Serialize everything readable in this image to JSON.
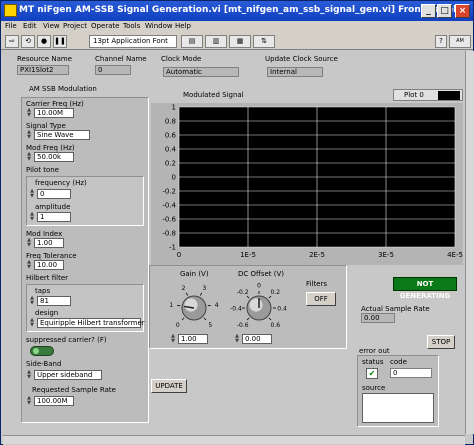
{
  "window": {
    "title": "MT niFgen AM-SSB Signal Generation.vi [mt_nifgen_am_ssb_signal_gen.vi] Front Panel"
  },
  "menu": [
    "File",
    "Edit",
    "View",
    "Project",
    "Operate",
    "Tools",
    "Window",
    "Help"
  ],
  "toolbar": {
    "font": "13pt Application Font"
  },
  "top": {
    "resource_name_label": "Resource Name",
    "resource_name": "PXI1Slot2",
    "channel_name_label": "Channel Name",
    "channel_name": "0",
    "clock_mode_label": "Clock Mode",
    "clock_mode": "Automatic",
    "update_clock_label": "Update Clock Source",
    "update_clock": "Internal"
  },
  "am": {
    "group_label": "AM SSB Modulation",
    "carrier_label": "Carrier Freq (Hz)",
    "carrier": "10.00M",
    "signal_type_label": "Signal Type",
    "signal_type": "Sine Wave",
    "mod_freq_label": "Mod Freq (Hz)",
    "mod_freq": "50.00k",
    "pilot_label": "Pilot tone",
    "pilot_freq_label": "frequency (Hz)",
    "pilot_freq": "0",
    "pilot_amp_label": "amplitude",
    "pilot_amp": "1",
    "mod_index_label": "Mod Index",
    "mod_index": "1.00",
    "freq_tol_label": "Freq Tolerance",
    "freq_tol": "10.00",
    "hilbert_label": "Hilbert filter",
    "taps_label": "taps",
    "taps": "81",
    "design_label": "design",
    "design": "Equiripple Hilbert transformer",
    "suppressed_label": "suppressed carrier? (F)",
    "sideband_label": "Side-Band",
    "sideband": "Upper sideband",
    "req_rate_label": "Requested Sample Rate",
    "req_rate": "100.00M"
  },
  "chart_data": {
    "type": "line",
    "title": "Modulated Signal",
    "legend": "Plot 0",
    "xlim": [
      0,
      4e-05
    ],
    "ylim": [
      -1,
      1
    ],
    "x_ticks": [
      "0",
      "1E-5",
      "2E-5",
      "3E-5",
      "4E-5"
    ],
    "y_ticks": [
      "1",
      "0.8",
      "0.6",
      "0.4",
      "0.2",
      "0",
      "-0.2",
      "-0.4",
      "-0.6",
      "-0.8",
      "-1"
    ],
    "series": [],
    "grid": true
  },
  "knobs": {
    "gain_label": "Gain (V)",
    "gain_ticks": [
      "0",
      "1",
      "2",
      "3",
      "4",
      "5"
    ],
    "gain_value": "1.00",
    "gain_fraction": 0.2,
    "offset_label": "DC Offset (V)",
    "offset_ticks": [
      "-0.6",
      "-0.4",
      "-0.2",
      "0",
      "0.2",
      "0.4",
      "0.6"
    ],
    "offset_value": "0.00",
    "offset_fraction": 0.5
  },
  "filters": {
    "label": "Filters",
    "state": "OFF"
  },
  "status": {
    "not_generating": "NOT GENERATING",
    "actual_rate_label": "Actual Sample Rate",
    "actual_rate": "0.00",
    "stop": "STOP",
    "update": "UPDATE",
    "error_out_label": "error out",
    "status_label": "status",
    "code_label": "code",
    "code": "0",
    "source_label": "source"
  }
}
